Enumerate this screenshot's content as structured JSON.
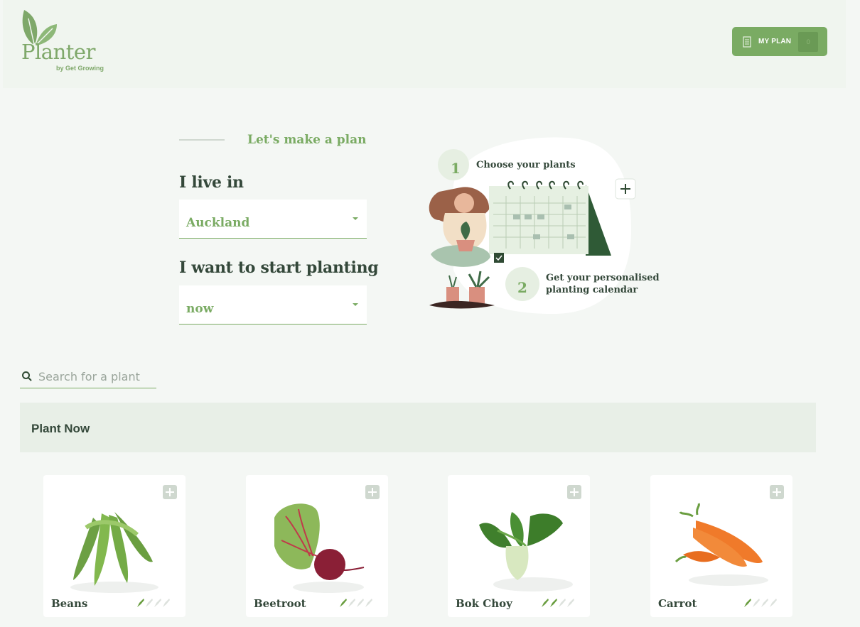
{
  "brand": {
    "name": "Planter",
    "tagline": "by Get Growing"
  },
  "header": {
    "my_plan_label": "MY PLAN",
    "my_plan_count": "0"
  },
  "plan_form": {
    "kicker": "Let's make a plan",
    "location_question": "I live in",
    "location_value": "Auckland",
    "start_question": "I want to start planting",
    "start_value": "now"
  },
  "illustration": {
    "step1_number": "1",
    "step1_text": "Choose your plants",
    "step2_number": "2",
    "step2_line1": "Get your personalised",
    "step2_line2": "planting calendar"
  },
  "search": {
    "placeholder": "Search for a plant"
  },
  "section": {
    "title": "Plant Now"
  },
  "plants": [
    {
      "name": "Beans",
      "difficulty": 1,
      "difficulty_max": 4
    },
    {
      "name": "Beetroot",
      "difficulty": 1,
      "difficulty_max": 4
    },
    {
      "name": "Bok Choy",
      "difficulty": 2,
      "difficulty_max": 4
    },
    {
      "name": "Carrot",
      "difficulty": 1,
      "difficulty_max": 4
    }
  ],
  "colors": {
    "brand_green": "#7aab63",
    "dark_green": "#2f4a33",
    "page_bg": "#f4f7f4",
    "section_bg": "#e8efe7"
  }
}
